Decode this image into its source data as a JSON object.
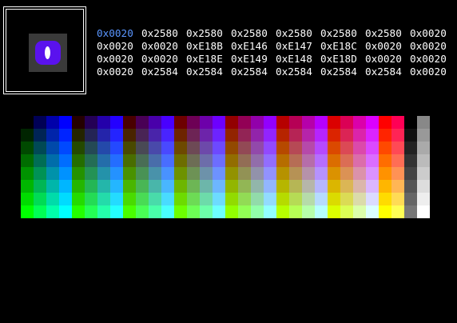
{
  "preview": {
    "glyph_icon": "glyph-preview-icon",
    "glyph_color": "#5a12ee",
    "cell_color": "#3a3a3a"
  },
  "hex_grid": {
    "selected": {
      "row": 0,
      "col": 0
    },
    "rows": [
      [
        "0x0020",
        "0x2580",
        "0x2580",
        "0x2580",
        "0x2580",
        "0x2580",
        "0x2580",
        "0x0020"
      ],
      [
        "0x0020",
        "0x0020",
        "0xE18B",
        "0xE146",
        "0xE147",
        "0xE18C",
        "0x0020",
        "0x0020"
      ],
      [
        "0x0020",
        "0x0020",
        "0xE18E",
        "0xE149",
        "0xE148",
        "0xE18D",
        "0x0020",
        "0x0020"
      ],
      [
        "0x0020",
        "0x2584",
        "0x2584",
        "0x2584",
        "0x2584",
        "0x2584",
        "0x2584",
        "0x0020"
      ]
    ]
  },
  "palette": {
    "columns": 32,
    "rows": 8,
    "accent_selected_color": "#5a96ff"
  }
}
